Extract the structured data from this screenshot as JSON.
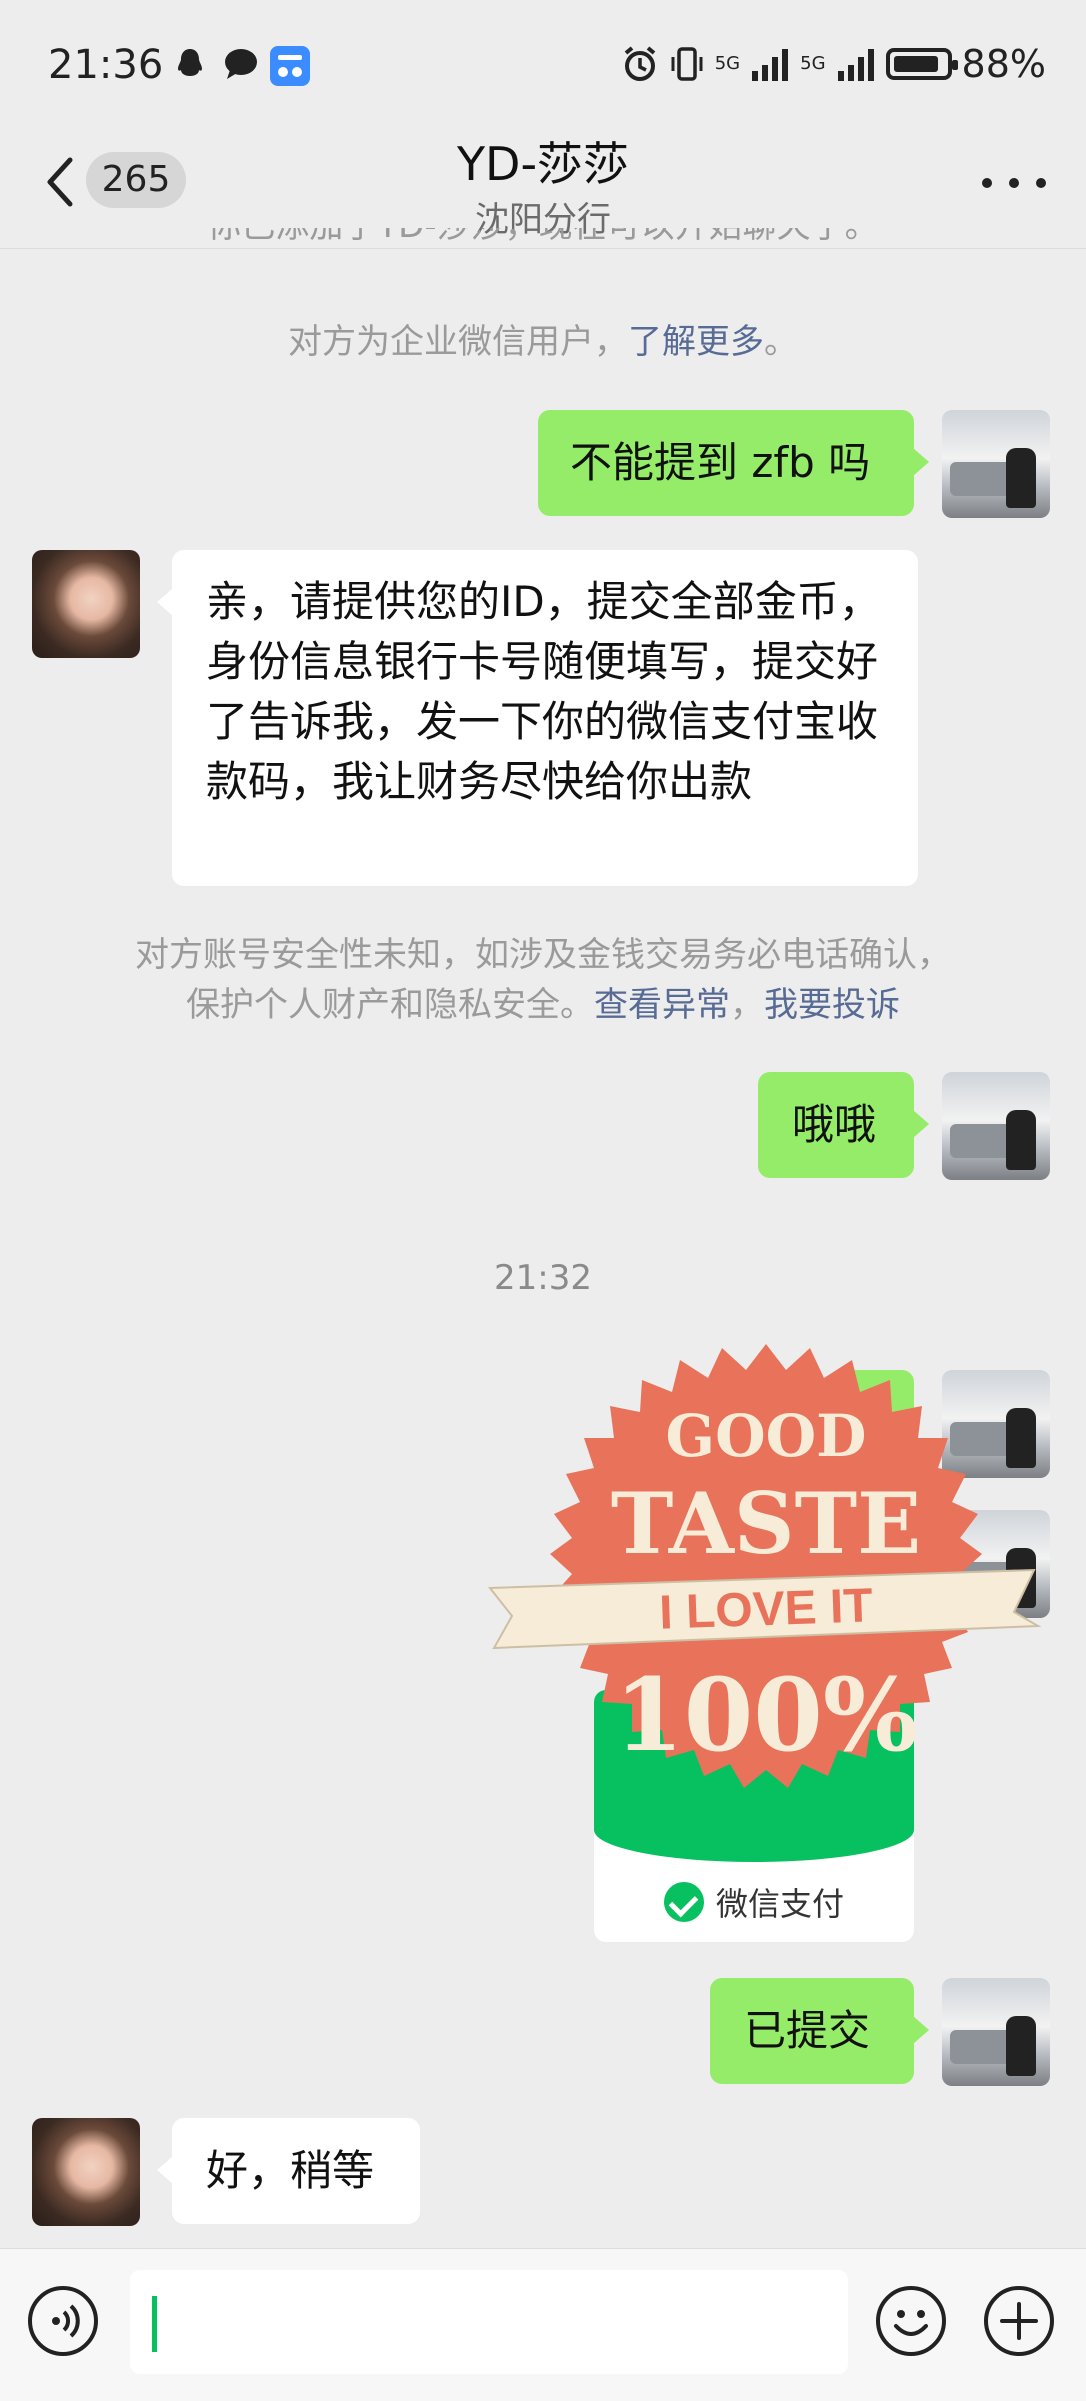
{
  "status_bar": {
    "time": "21:36",
    "battery": "88%",
    "network": "5G",
    "notification_icons": [
      "qq-icon",
      "message-icon",
      "car-app-icon"
    ]
  },
  "header": {
    "unread_count": "265",
    "title": "YD-莎莎",
    "subtitle": "沈阳分行"
  },
  "chat": {
    "system_top_cut": "你已添加了YD-莎莎，现在可以开始聊天了。",
    "system_enterprise_text": "对方为企业微信用户，",
    "system_enterprise_link": "了解更多",
    "system_enterprise_end": "。",
    "msg_me_1": "不能提到 zfb 吗",
    "msg_her_1": "亲，请提供您的ID，提交全部金币，身份信息银行卡号随便填写，提交好了告诉我，发一下你的微信支付宝收款码，我让财务尽快给你出款",
    "warning_line1": "对方账号安全性未知，如涉及金钱交易务必电话确认，",
    "warning_line2_text": "保护个人财产和隐私安全。",
    "warning_link_1": "查看异常",
    "warning_sep": "，",
    "warning_link_2": "我要投诉",
    "msg_me_2": "哦哦",
    "timestamp": "21:32",
    "sticker": {
      "line1": "GOOD",
      "line2": "TASTE",
      "ribbon": "I LOVE IT",
      "line3": "100%"
    },
    "pay_card_label": "微信支付",
    "msg_me_3": "已提交",
    "msg_her_2": "好，稍等"
  },
  "colors": {
    "bg": "#ededed",
    "bubble_green": "#95ec69",
    "link": "#576b95",
    "wechat_green": "#07c160",
    "sticker_orange": "#e8735a",
    "sticker_cream": "#f7ecd8"
  }
}
